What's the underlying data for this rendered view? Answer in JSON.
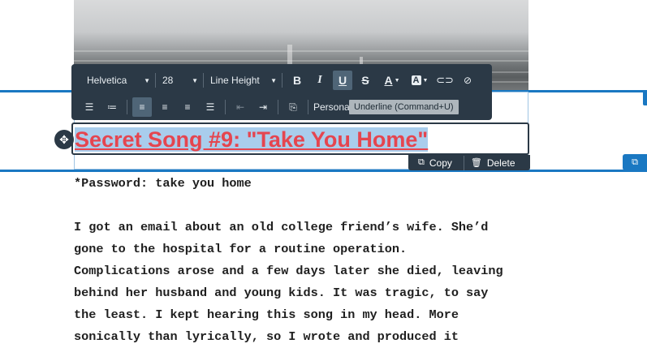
{
  "toolbar": {
    "font_family": "Helvetica",
    "font_size": "28",
    "line_height": "Line Height",
    "personalize": "Personalize",
    "tooltip": "Underline (Command+U)",
    "icons": [
      "bold-icon",
      "italic-icon",
      "underline-icon",
      "strikethrough-icon",
      "text-color-icon",
      "highlight-color-icon",
      "link-icon",
      "clear-format-icon",
      "ordered-list-icon",
      "unordered-list-icon",
      "align-left-icon",
      "align-center-icon",
      "align-right-icon",
      "align-justify-icon",
      "outdent-icon",
      "indent-icon",
      "source-icon"
    ]
  },
  "heading": {
    "text": "Secret Song #9: \"Take You Home\"",
    "color": "#e5454f"
  },
  "actions": {
    "copy_label": "Copy",
    "delete_label": "Delete"
  },
  "body": {
    "password": "*Password: take you home",
    "lines": [
      "I got an email about an old college friend’s wife. She’d",
      "gone to the hospital for a routine operation.",
      "Complications arose and a few days later she died, leaving",
      "behind her husband and young kids. It was tragic, to say",
      "the least. I kept hearing this song in my head. More",
      "sonically than lyrically, so I wrote and produced it"
    ]
  },
  "colors": {
    "accent": "#1a78c2",
    "toolbar_bg": "#2b3946"
  }
}
